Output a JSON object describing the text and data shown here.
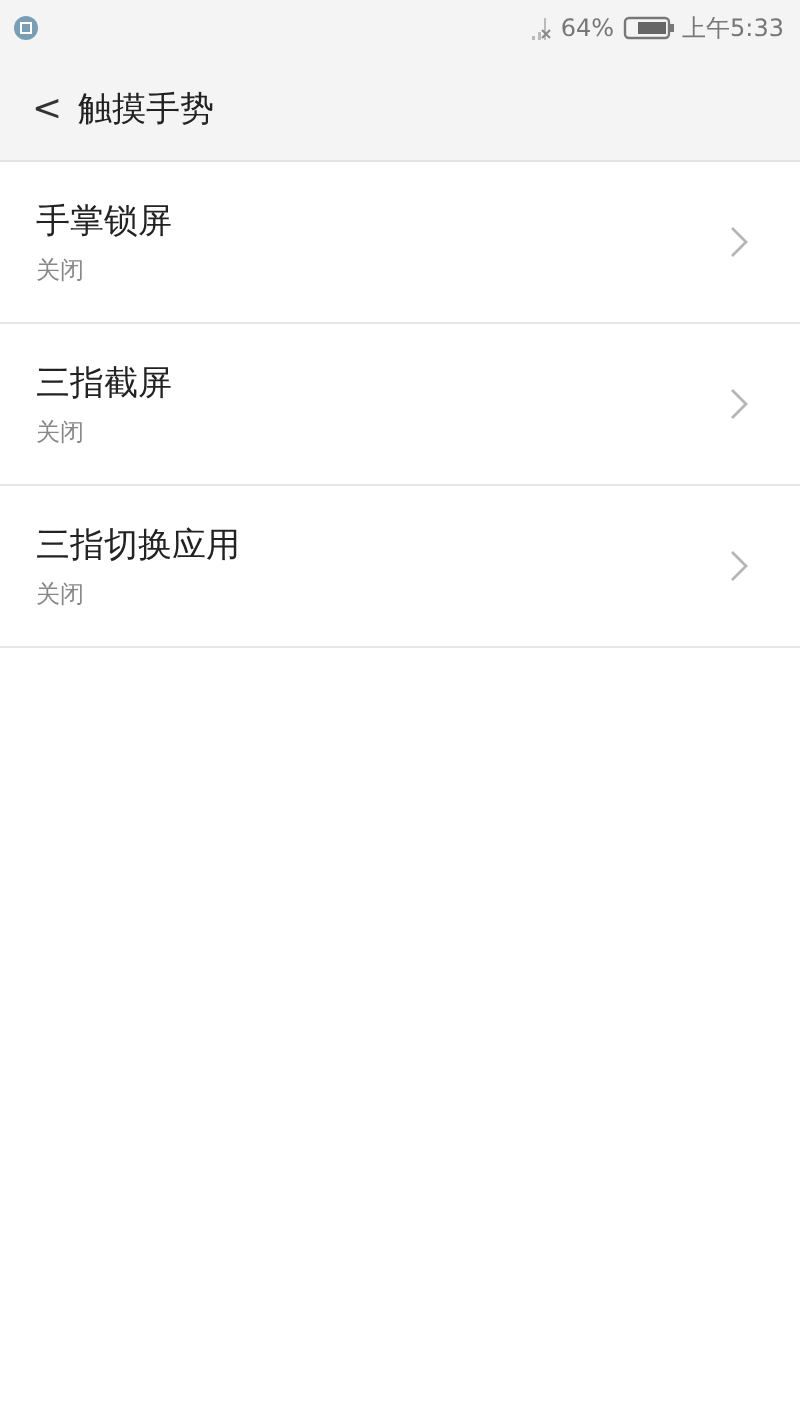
{
  "status_bar": {
    "battery": "64%",
    "time": "上午5:33"
  },
  "header": {
    "back": "<",
    "title": "触摸手势"
  },
  "items": [
    {
      "title": "手掌锁屏",
      "value": "关闭"
    },
    {
      "title": "三指截屏",
      "value": "关闭"
    },
    {
      "title": "三指切换应用",
      "value": "关闭"
    }
  ]
}
